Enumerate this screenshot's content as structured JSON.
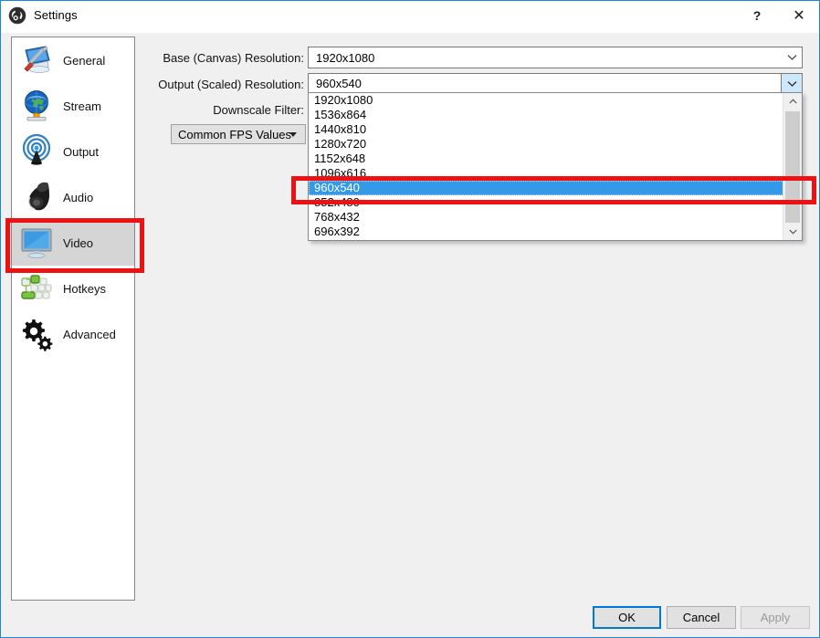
{
  "window": {
    "title": "Settings",
    "icon": "obs-logo-icon",
    "help_label": "?",
    "close_label": "✕",
    "border_color": "#1d86d0",
    "background": "#f0f0f0"
  },
  "sidebar": {
    "items": [
      {
        "label": "General",
        "icon": "general-icon",
        "selected": false
      },
      {
        "label": "Stream",
        "icon": "stream-icon",
        "selected": false
      },
      {
        "label": "Output",
        "icon": "output-icon",
        "selected": false
      },
      {
        "label": "Audio",
        "icon": "audio-icon",
        "selected": false
      },
      {
        "label": "Video",
        "icon": "video-icon",
        "selected": true
      },
      {
        "label": "Hotkeys",
        "icon": "hotkeys-icon",
        "selected": false
      },
      {
        "label": "Advanced",
        "icon": "advanced-icon",
        "selected": false
      }
    ]
  },
  "main": {
    "fields": {
      "base_resolution": {
        "label": "Base (Canvas) Resolution:",
        "value": "1920x1080"
      },
      "output_resolution": {
        "label": "Output (Scaled) Resolution:",
        "value": "960x540",
        "expanded": true
      },
      "downscale_filter": {
        "label": "Downscale Filter:"
      },
      "fps_type": {
        "value": "Common FPS Values"
      }
    },
    "dropdown": {
      "options": [
        "1920x1080",
        "1536x864",
        "1440x810",
        "1280x720",
        "1152x648",
        "1096x616",
        "960x540",
        "852x480",
        "768x432",
        "696x392"
      ],
      "selected": "960x540",
      "selected_color": "#3399e8"
    }
  },
  "footer": {
    "ok_label": "OK",
    "cancel_label": "Cancel",
    "apply_label": "Apply",
    "apply_enabled": false
  },
  "annotations": {
    "color": "#ee1111",
    "regions": [
      {
        "name": "video-sidebar-highlight"
      },
      {
        "name": "selected-option-highlight"
      }
    ]
  }
}
